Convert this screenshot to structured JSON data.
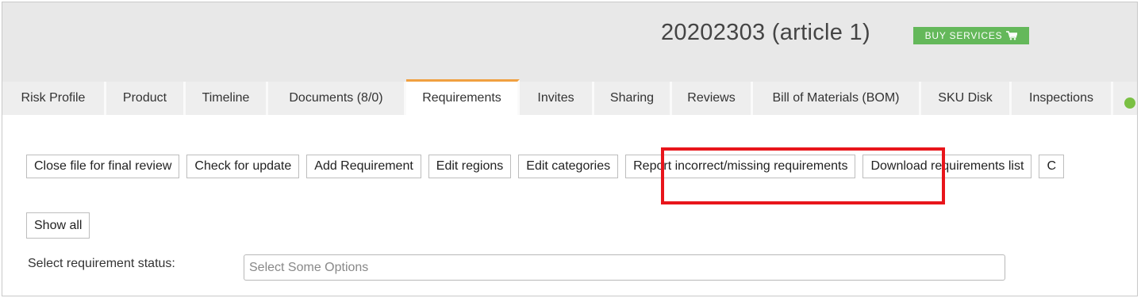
{
  "header": {
    "title": "20202303 (article 1)",
    "buy_services_label": "BUY SERVICES",
    "buy_icon": "cart-icon",
    "buy_color": "#64b85a"
  },
  "tabs": [
    {
      "label": "Risk Profile",
      "active": false
    },
    {
      "label": "Product",
      "active": false
    },
    {
      "label": "Timeline",
      "active": false
    },
    {
      "label": "Documents (8/0)",
      "active": false
    },
    {
      "label": "Requirements",
      "active": true
    },
    {
      "label": "Invites",
      "active": false
    },
    {
      "label": "Sharing",
      "active": false
    },
    {
      "label": "Reviews",
      "active": false
    },
    {
      "label": "Bill of Materials (BOM)",
      "active": false
    },
    {
      "label": "SKU Disk",
      "active": false
    },
    {
      "label": "Inspections",
      "active": false
    }
  ],
  "tab_accent_color": "#f0a040",
  "actions": {
    "close_file": "Close file for final review",
    "check_update": "Check for update",
    "add_requirement": "Add Requirement",
    "edit_regions": "Edit regions",
    "edit_categories": "Edit categories",
    "report_incorrect": "Report incorrect/missing requirements",
    "download_list": "Download requirements list",
    "truncated": "C"
  },
  "highlight_color": "#e8151b",
  "show_all_label": "Show all",
  "status_filter": {
    "label": "Select requirement status:",
    "placeholder": "Select Some Options"
  }
}
